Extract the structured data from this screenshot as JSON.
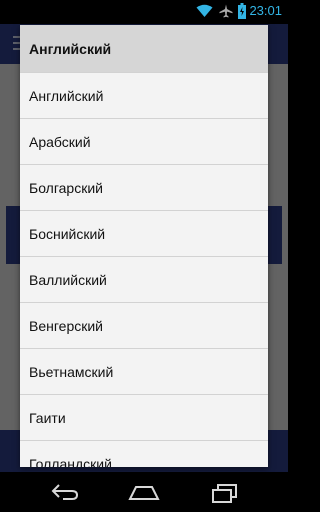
{
  "status_bar": {
    "time": "23:01",
    "icons": [
      "wifi-icon",
      "airplane-icon",
      "battery-icon"
    ]
  },
  "language_dropdown": {
    "selected": "Английский",
    "options": [
      "Английский",
      "Арабский",
      "Болгарский",
      "Боснийский",
      "Валлийский",
      "Венгерский",
      "Вьетнамский",
      "Гаити",
      "Голландский"
    ]
  },
  "navigation_bar": {
    "buttons": [
      "back-icon",
      "home-icon",
      "recent-apps-icon"
    ]
  },
  "colors": {
    "accent": "#33b5e5",
    "app_primary": "#2d3c86"
  }
}
